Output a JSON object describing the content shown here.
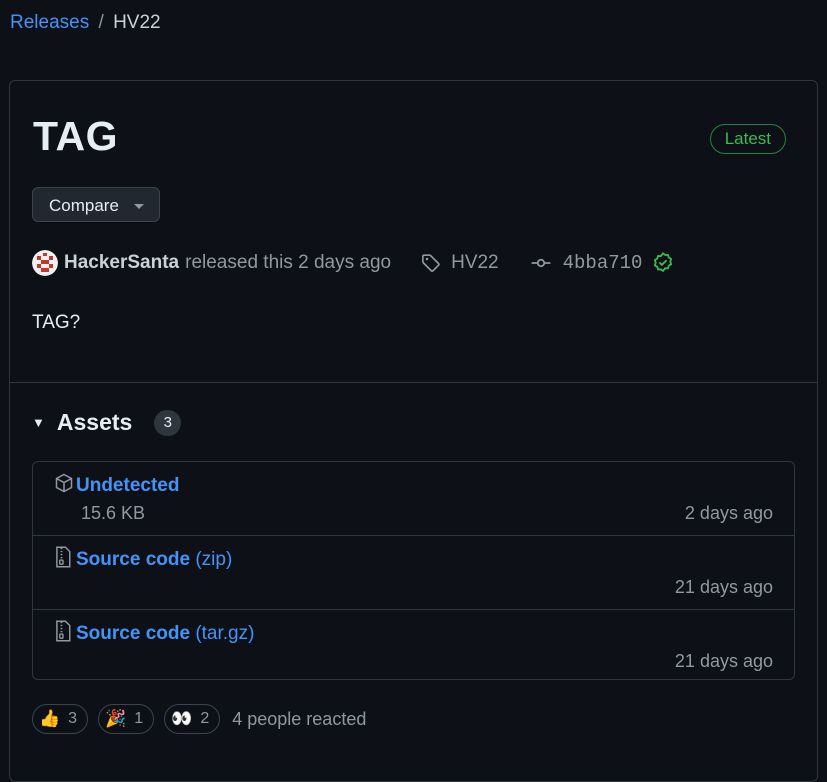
{
  "theme": {
    "bg": "#0d1117",
    "accent": "#4493f8",
    "success": "#3fb950"
  },
  "breadcrumb": {
    "parent": "Releases",
    "separator": "/",
    "current": "HV22"
  },
  "release": {
    "title": "TAG",
    "badge": "Latest",
    "compare_label": "Compare",
    "author": "HackerSanta",
    "released_text": "released this 2 days ago",
    "tag": "HV22",
    "commit": "4bba710",
    "body": "TAG?"
  },
  "assets": {
    "heading": "Assets",
    "count": "3",
    "items": [
      {
        "name": "Undetected",
        "ext": "",
        "size": "15.6 KB",
        "date": "2 days ago",
        "icon": "package-icon"
      },
      {
        "name": "Source code",
        "ext": "(zip)",
        "size": "",
        "date": "21 days ago",
        "icon": "file-zip-icon"
      },
      {
        "name": "Source code",
        "ext": "(tar.gz)",
        "size": "",
        "date": "21 days ago",
        "icon": "file-zip-icon"
      }
    ]
  },
  "reactions": {
    "items": [
      {
        "emoji": "👍",
        "count": "3",
        "name": "thumbs-up"
      },
      {
        "emoji": "🎉",
        "count": "1",
        "name": "hooray"
      },
      {
        "emoji": "👀",
        "count": "2",
        "name": "eyes"
      }
    ],
    "summary": "4 people reacted"
  }
}
